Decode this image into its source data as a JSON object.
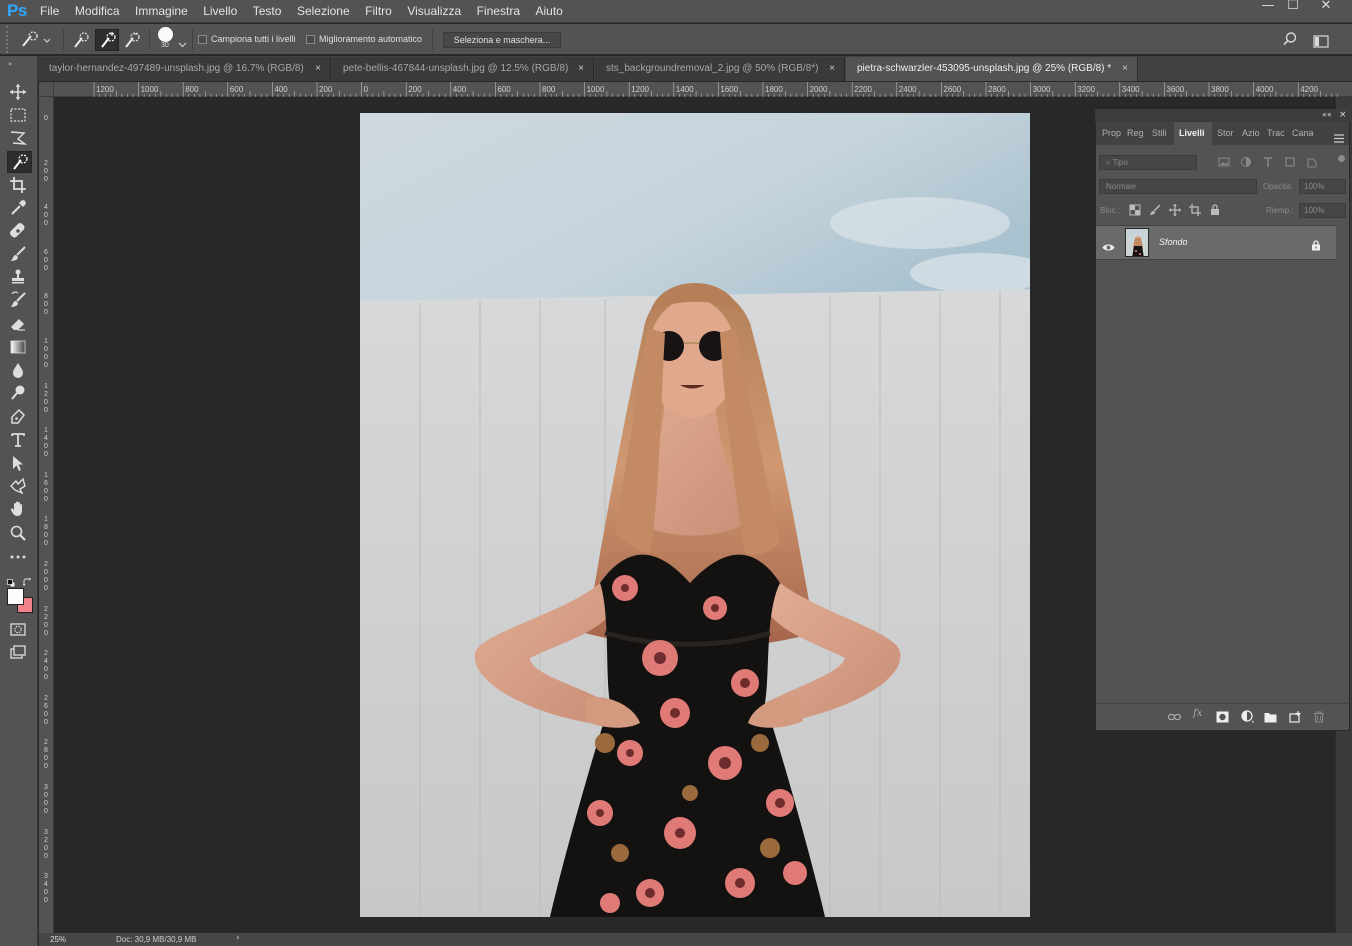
{
  "app": {
    "logo": "Ps"
  },
  "menu": [
    "File",
    "Modifica",
    "Immagine",
    "Livello",
    "Testo",
    "Selezione",
    "Filtro",
    "Visualizza",
    "Finestra",
    "Aiuto"
  ],
  "window_controls": {
    "minimize": "—",
    "maximize": "☐",
    "close": "✕"
  },
  "options": {
    "brush_size": "30",
    "sample_all_layers": "Campiona tutti i livelli",
    "auto_enhance": "Miglioramento automatico",
    "select_and_mask": "Seleziona e maschera..."
  },
  "tabs": [
    {
      "label": "taylor-hernandez-497489-unsplash.jpg @ 16.7% (RGB/8)",
      "close": "×"
    },
    {
      "label": "pete-bellis-467844-unsplash.jpg @ 12.5% (RGB/8)",
      "close": "×"
    },
    {
      "label": "sts_backgroundremoval_2.jpg @ 50% (RGB/8*)",
      "close": "×"
    },
    {
      "label": "pietra-schwarzler-453095-unsplash.jpg @ 25% (RGB/8) *",
      "close": "×"
    }
  ],
  "ruler_h": [
    "1200",
    "1000",
    "800",
    "600",
    "400",
    "200",
    "0",
    "200",
    "400",
    "600",
    "800",
    "1000",
    "1200",
    "1400",
    "1600",
    "1800",
    "2000",
    "2200",
    "2400",
    "2600",
    "2800",
    "3000",
    "3200",
    "3400",
    "3600",
    "3800",
    "4000",
    "4200"
  ],
  "ruler_v": [
    "0",
    "200",
    "400",
    "600",
    "800",
    "1000",
    "1200",
    "1400",
    "1600",
    "1800",
    "2000",
    "2200",
    "2400",
    "2600",
    "2800",
    "3000",
    "3200",
    "3400",
    "3600"
  ],
  "status": {
    "zoom": "25%",
    "doc": "Doc: 30,9 MB/30,9 MB",
    "arrow": "›"
  },
  "panel": {
    "tabs": [
      "Prop",
      "Reg",
      "Stili",
      "Livelli",
      "Stor",
      "Azio",
      "Trac",
      "Cana"
    ],
    "active_tab": "Livelli",
    "filter_placeholder": "Tipo",
    "blend_mode": "Normale",
    "opacity_label": "Opacità:",
    "opacity_value": "100%",
    "lock_label": "Bloc.:",
    "fill_label": "Riemp.:",
    "fill_value": "100%",
    "layers": [
      {
        "name": "Sfondo"
      }
    ]
  }
}
